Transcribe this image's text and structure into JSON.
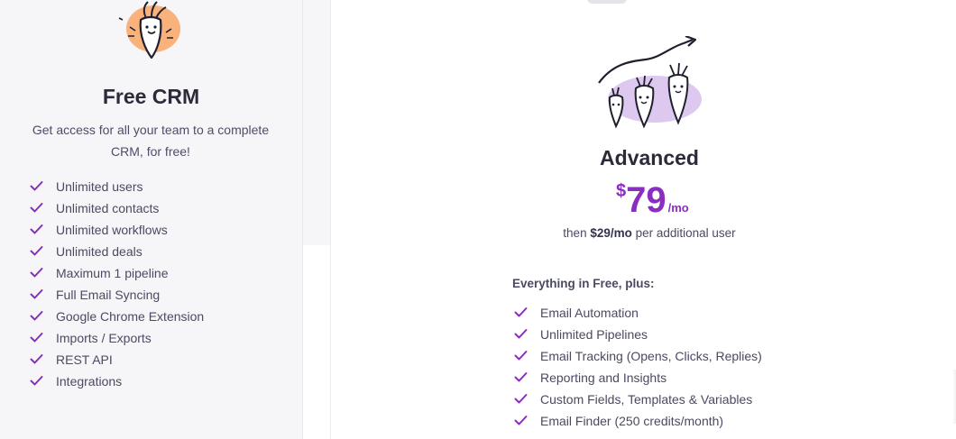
{
  "colors": {
    "accent_purple": "#8a2ec0",
    "check_purple": "#8a2ec0",
    "free_card_bg": "#f6f6f9",
    "free_illus_blob": "#f9b27c",
    "adv_illus_blob": "#ddc8f0"
  },
  "icons": {
    "check": "checkmark-icon",
    "free_illustration": "single-carrot-illustration",
    "advanced_illustration": "three-carrots-growth-arrow-illustration"
  },
  "free_plan": {
    "title": "Free CRM",
    "description": "Get access for all your team to a complete CRM, for free!",
    "features": [
      "Unlimited users",
      "Unlimited contacts",
      "Unlimited workflows",
      "Unlimited deals",
      "Maximum 1 pipeline",
      "Full Email Syncing",
      "Google Chrome Extension",
      "Imports / Exports",
      "REST API",
      "Integrations"
    ]
  },
  "advanced_plan": {
    "title": "Advanced",
    "currency": "$",
    "price": "79",
    "per": "/mo",
    "sub_prefix": "then ",
    "sub_price": "$29/mo",
    "sub_suffix": " per additional user",
    "includes_label": "Everything in Free, plus:",
    "features": [
      "Email Automation",
      "Unlimited Pipelines",
      "Email Tracking (Opens, Clicks, Replies)",
      "Reporting and Insights",
      "Custom Fields, Templates & Variables",
      "Email Finder (250 credits/month)"
    ]
  }
}
